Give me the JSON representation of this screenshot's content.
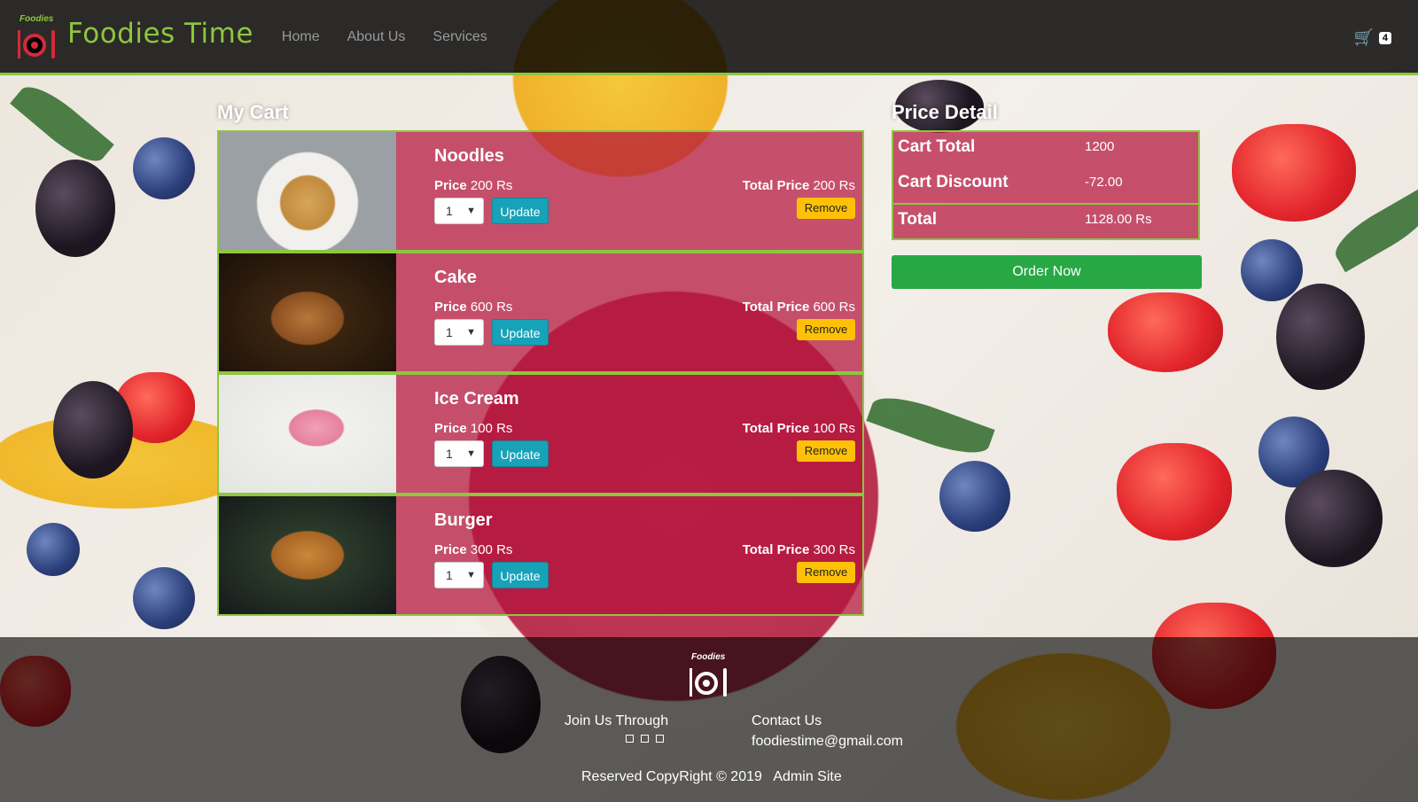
{
  "brand": {
    "logo_text": "Foodies",
    "name": "Foodies Time"
  },
  "nav": {
    "links": [
      "Home",
      "About Us",
      "Services"
    ],
    "cart_count": "4"
  },
  "cart": {
    "title": "My Cart",
    "items": [
      {
        "name": "Noodles",
        "price_label": "Price",
        "price": "200 Rs",
        "qty": "1",
        "update": "Update",
        "total_label": "Total Price",
        "total": "200 Rs",
        "remove": "Remove"
      },
      {
        "name": "Cake",
        "price_label": "Price",
        "price": "600 Rs",
        "qty": "1",
        "update": "Update",
        "total_label": "Total Price",
        "total": "600 Rs",
        "remove": "Remove"
      },
      {
        "name": "Ice Cream",
        "price_label": "Price",
        "price": "100 Rs",
        "qty": "1",
        "update": "Update",
        "total_label": "Total Price",
        "total": "100 Rs",
        "remove": "Remove"
      },
      {
        "name": "Burger",
        "price_label": "Price",
        "price": "300 Rs",
        "qty": "1",
        "update": "Update",
        "total_label": "Total Price",
        "total": "300 Rs",
        "remove": "Remove"
      }
    ]
  },
  "price_detail": {
    "title": "Price Detail",
    "cart_total_label": "Cart Total",
    "cart_total": "1200",
    "discount_label": "Cart Discount",
    "discount": "-72.00",
    "total_label": "Total",
    "total": "1128.00 Rs",
    "order_button": "Order Now"
  },
  "footer": {
    "logo_text": "Foodies",
    "join": "Join Us Through",
    "contact_title": "Contact Us",
    "email": "foodiestime@gmail.com",
    "copyright": "Reserved CopyRight © 2019",
    "admin": "Admin Site"
  },
  "colors": {
    "accent": "#8dc63f",
    "card": "#b4123c",
    "update": "#17a2b8",
    "remove": "#ffc107",
    "order": "#28a745"
  }
}
